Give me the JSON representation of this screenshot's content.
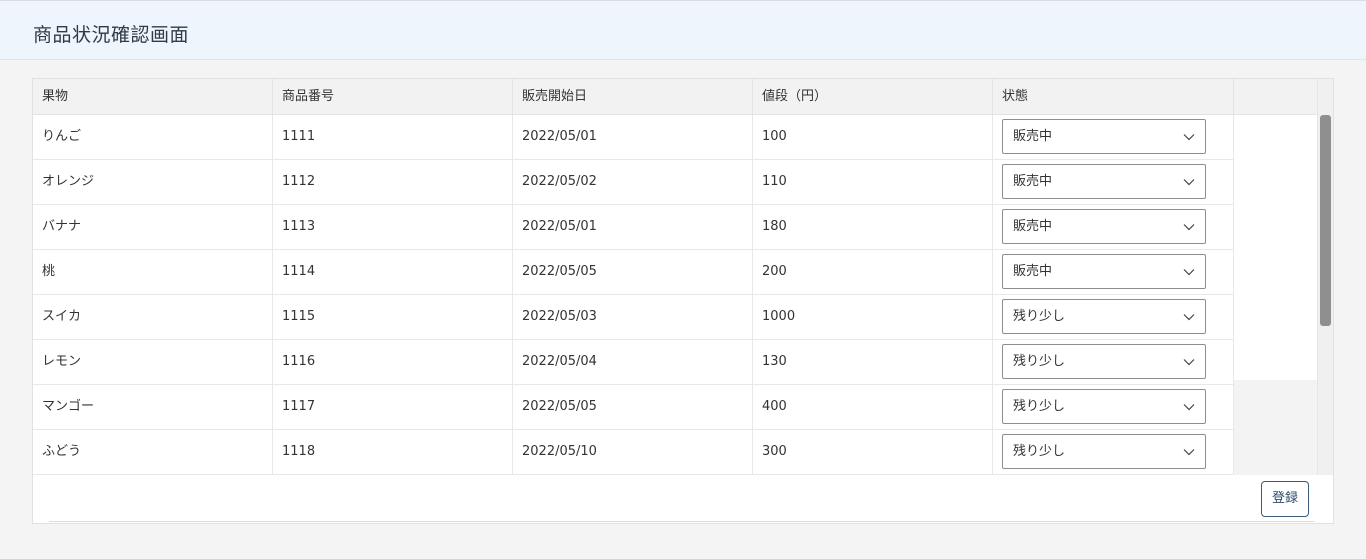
{
  "header": {
    "title": "商品状況確認画面"
  },
  "table": {
    "columns": [
      "果物",
      "商品番号",
      "販売開始日",
      "値段（円）",
      "状態"
    ],
    "rows": [
      {
        "fruit": "りんご",
        "code": "1111",
        "start": "2022/05/01",
        "price": "100",
        "status": "販売中"
      },
      {
        "fruit": "オレンジ",
        "code": "1112",
        "start": "2022/05/02",
        "price": "110",
        "status": "販売中"
      },
      {
        "fruit": "バナナ",
        "code": "1113",
        "start": "2022/05/01",
        "price": "180",
        "status": "販売中"
      },
      {
        "fruit": "桃",
        "code": "1114",
        "start": "2022/05/05",
        "price": "200",
        "status": "販売中"
      },
      {
        "fruit": "スイカ",
        "code": "1115",
        "start": "2022/05/03",
        "price": "1000",
        "status": "残り少し"
      },
      {
        "fruit": "レモン",
        "code": "1116",
        "start": "2022/05/04",
        "price": "130",
        "status": "残り少し"
      },
      {
        "fruit": "マンゴー",
        "code": "1117",
        "start": "2022/05/05",
        "price": "400",
        "status": "残り少し"
      },
      {
        "fruit": "ふどう",
        "code": "1118",
        "start": "2022/05/10",
        "price": "300",
        "status": "残り少し"
      }
    ]
  },
  "footer": {
    "register_label": "登録"
  },
  "icons": {
    "select_chevron": "chevron-down-icon"
  },
  "colors": {
    "header_bg": "#eef5fc",
    "button_border": "#3a5a7a"
  }
}
